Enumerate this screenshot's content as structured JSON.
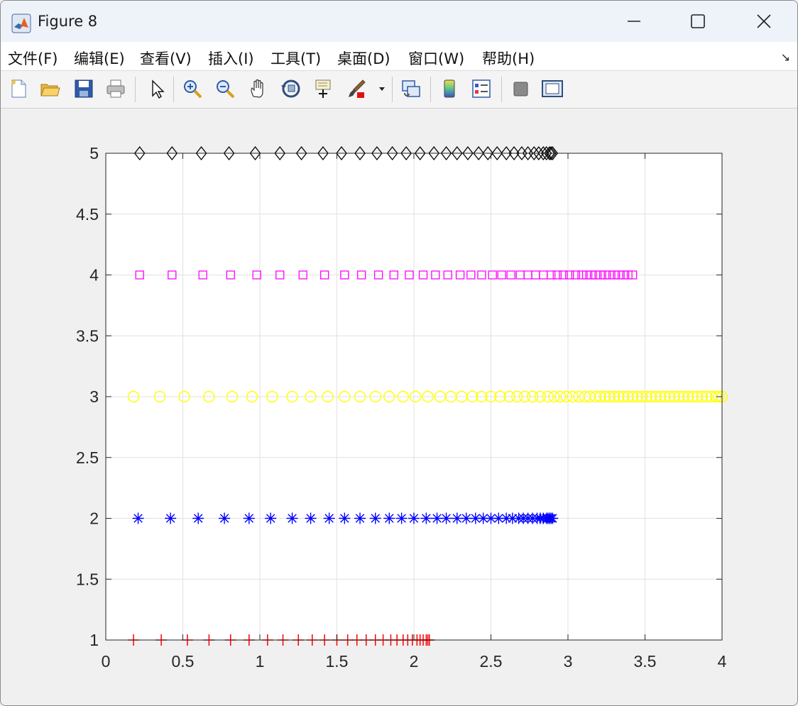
{
  "window": {
    "title": "Figure 8"
  },
  "menu": [
    "文件(F)",
    "编辑(E)",
    "查看(V)",
    "插入(I)",
    "工具(T)",
    "桌面(D)",
    "窗口(W)",
    "帮助(H)"
  ],
  "toolbar": [
    "new-figure-icon",
    "open-icon",
    "save-icon",
    "print-icon",
    "pointer-icon",
    "zoom-in-icon",
    "zoom-out-icon",
    "pan-icon",
    "rotate-3d-icon",
    "data-cursor-icon",
    "brush-icon",
    "link-plot-icon",
    "colorbar-icon",
    "legend-icon",
    "hide-plot-tools-icon",
    "show-plot-tools-icon"
  ],
  "chart_data": {
    "type": "scatter",
    "xlim": [
      0,
      4
    ],
    "ylim": [
      1,
      5
    ],
    "xticks": [
      0,
      0.5,
      1,
      1.5,
      2,
      2.5,
      3,
      3.5,
      4
    ],
    "xticklabels": [
      "0",
      "0.5",
      "1",
      "1.5",
      "2",
      "2.5",
      "3",
      "3.5",
      "4"
    ],
    "yticks": [
      1,
      1.5,
      2,
      2.5,
      3,
      3.5,
      4,
      4.5,
      5
    ],
    "yticklabels": [
      "1",
      "1.5",
      "2",
      "2.5",
      "3",
      "3.5",
      "4",
      "4.5",
      "5"
    ],
    "grid": true,
    "series": [
      {
        "y": 1,
        "marker": "plus",
        "color": "#ff0000",
        "x": [
          0.18,
          0.36,
          0.53,
          0.67,
          0.81,
          0.93,
          1.05,
          1.15,
          1.25,
          1.34,
          1.42,
          1.5,
          1.57,
          1.63,
          1.69,
          1.75,
          1.8,
          1.85,
          1.89,
          1.93,
          1.96,
          1.99,
          2.02,
          2.04,
          2.06,
          2.08,
          2.09,
          2.1
        ]
      },
      {
        "y": 2,
        "marker": "asterisk",
        "color": "#0000ff",
        "x": [
          0.21,
          0.42,
          0.6,
          0.77,
          0.93,
          1.07,
          1.21,
          1.33,
          1.45,
          1.55,
          1.65,
          1.75,
          1.84,
          1.92,
          2.0,
          2.08,
          2.15,
          2.21,
          2.28,
          2.34,
          2.4,
          2.45,
          2.5,
          2.55,
          2.6,
          2.64,
          2.68,
          2.71,
          2.74,
          2.77,
          2.8,
          2.82,
          2.84,
          2.86,
          2.87,
          2.88,
          2.89,
          2.9
        ]
      },
      {
        "y": 3,
        "marker": "circle",
        "color": "#ffff00",
        "x": [
          0.18,
          0.35,
          0.51,
          0.67,
          0.82,
          0.95,
          1.08,
          1.21,
          1.33,
          1.44,
          1.55,
          1.65,
          1.75,
          1.84,
          1.93,
          2.01,
          2.09,
          2.17,
          2.24,
          2.31,
          2.38,
          2.44,
          2.5,
          2.56,
          2.62,
          2.67,
          2.72,
          2.77,
          2.82,
          2.87,
          2.91,
          2.95,
          2.99,
          3.03,
          3.07,
          3.11,
          3.14,
          3.18,
          3.21,
          3.24,
          3.27,
          3.3,
          3.33,
          3.36,
          3.39,
          3.42,
          3.45,
          3.48,
          3.51,
          3.54,
          3.57,
          3.6,
          3.63,
          3.66,
          3.69,
          3.72,
          3.75,
          3.78,
          3.81,
          3.84,
          3.87,
          3.9,
          3.93,
          3.96,
          3.98,
          4.0
        ]
      },
      {
        "y": 4,
        "marker": "square",
        "color": "#ff00ff",
        "x": [
          0.22,
          0.43,
          0.63,
          0.81,
          0.98,
          1.13,
          1.28,
          1.42,
          1.55,
          1.66,
          1.77,
          1.87,
          1.97,
          2.06,
          2.14,
          2.22,
          2.3,
          2.37,
          2.44,
          2.51,
          2.57,
          2.63,
          2.69,
          2.74,
          2.79,
          2.84,
          2.89,
          2.93,
          2.97,
          3.01,
          3.05,
          3.09,
          3.12,
          3.15,
          3.18,
          3.21,
          3.24,
          3.27,
          3.3,
          3.33,
          3.36,
          3.39,
          3.42
        ]
      },
      {
        "y": 5,
        "marker": "diamond",
        "color": "#000000",
        "x": [
          0.22,
          0.43,
          0.62,
          0.8,
          0.97,
          1.13,
          1.27,
          1.41,
          1.53,
          1.65,
          1.76,
          1.86,
          1.95,
          2.04,
          2.13,
          2.21,
          2.28,
          2.35,
          2.42,
          2.48,
          2.54,
          2.6,
          2.65,
          2.7,
          2.74,
          2.78,
          2.81,
          2.84,
          2.86,
          2.88,
          2.89,
          2.9
        ]
      }
    ]
  }
}
